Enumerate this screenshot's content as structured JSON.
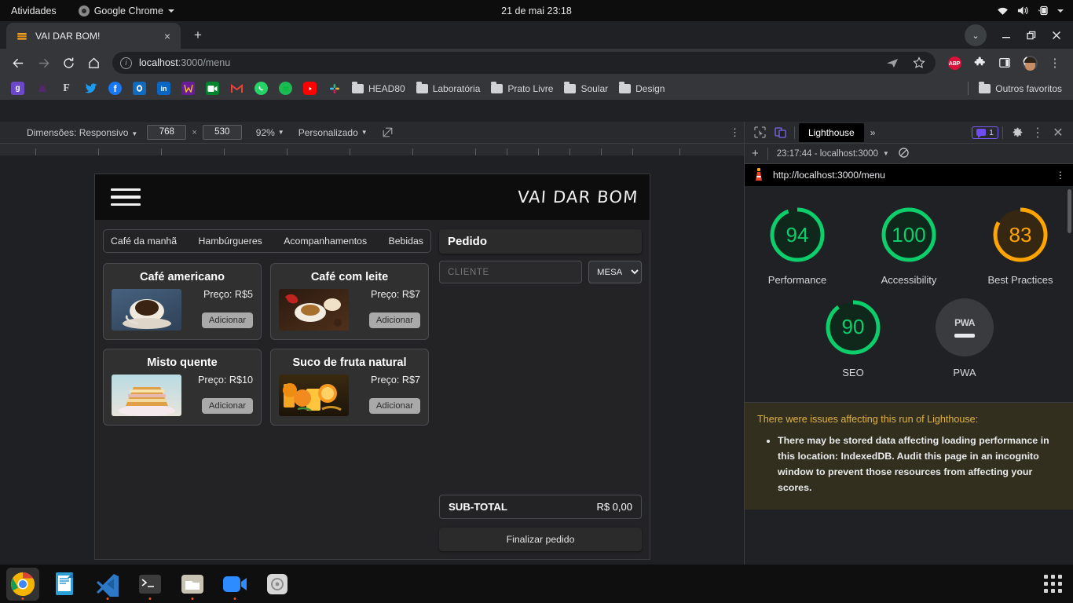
{
  "desktop": {
    "activities": "Atividades",
    "app_menu": "Google Chrome",
    "clock": "21 de mai  23:18",
    "tray": [
      "wifi-icon",
      "volume-icon",
      "battery-icon",
      "chevron-down-icon"
    ]
  },
  "chrome": {
    "tab": {
      "title": "VAI DAR BOM!",
      "favicon": "burger-icon",
      "close": "×"
    },
    "new_tab": "+",
    "window_controls": {
      "minimize": "—",
      "maximize": "❐",
      "close": "✕",
      "chevron": "⌄"
    },
    "nav": {
      "back": "←",
      "forward": "→",
      "reload": "⟳",
      "home": "⌂"
    },
    "omnibox": {
      "info_icon": "info-icon",
      "host": "localhost",
      "path": ":3000/menu",
      "share_icon": "share-icon",
      "star_icon": "star-icon"
    },
    "extensions": {
      "abp": "ABP",
      "puzzle": "extensions-icon",
      "sidepanel": "side-panel-icon",
      "menu": "⋮"
    },
    "bookmarks": {
      "icons": [
        {
          "name": "g-icon",
          "label": "g",
          "bg": "#6b48c8"
        },
        {
          "name": "bucks-icon",
          "label": "",
          "bg": "#4b2a74"
        },
        {
          "name": "f-serif-icon",
          "label": "F",
          "bg": "#1f2833"
        },
        {
          "name": "twitter-icon",
          "label": "",
          "bg": "#1f2833"
        },
        {
          "name": "facebook-icon",
          "label": "f",
          "bg": "#1877f2"
        },
        {
          "name": "outlook-icon",
          "label": "",
          "bg": "#0f6cbd"
        },
        {
          "name": "linkedin-icon",
          "label": "in",
          "bg": "#0a66c2"
        },
        {
          "name": "whats-icon",
          "label": "",
          "bg": "#6a1b9a"
        },
        {
          "name": "meet-icon",
          "label": "",
          "bg": "#00832d"
        },
        {
          "name": "gmail-icon",
          "label": "M",
          "bg": "#1f2833"
        },
        {
          "name": "whatsapp-icon",
          "label": "",
          "bg": "#25d366"
        },
        {
          "name": "spotify-icon",
          "label": "",
          "bg": "#1db954"
        },
        {
          "name": "youtube-icon",
          "label": "",
          "bg": "#ff0000"
        },
        {
          "name": "slack-icon",
          "label": "",
          "bg": "#1f2833"
        }
      ],
      "folders": [
        "HEAD80",
        "Laboratória",
        "Prato Livre",
        "Soular",
        "Design"
      ],
      "other": "Outros favoritos"
    }
  },
  "devtools": {
    "device_bar": {
      "dimensions_label": "Dimensões: Responsivo",
      "width": "768",
      "height": "530",
      "x": "×",
      "zoom": "92%",
      "throttling": "Personalizado",
      "rotate_icon": "rotate-icon",
      "more_icon": "⋮"
    }
  },
  "app": {
    "brand": "VAI DAR BOM",
    "menu_icon": "hamburger-menu-icon",
    "categories": [
      "Café da manhã",
      "Hambúrgueres",
      "Acompanhamentos",
      "Bebidas"
    ],
    "products": [
      {
        "name": "Café americano",
        "price": "Preço: R$5",
        "add": "Adicionar",
        "image": "coffee-cup-photo"
      },
      {
        "name": "Café com leite",
        "price": "Preço: R$7",
        "add": "Adicionar",
        "image": "latte-photo"
      },
      {
        "name": "Misto quente",
        "price": "Preço: R$10",
        "add": "Adicionar",
        "image": "sandwich-photo"
      },
      {
        "name": "Suco de fruta natural",
        "price": "Preço: R$7",
        "add": "Adicionar",
        "image": "orange-juice-photo"
      }
    ],
    "order": {
      "title": "Pedido",
      "client_placeholder": "CLIENTE",
      "client_value": "",
      "table_selected": "MESA",
      "table_options": [
        "MESA"
      ],
      "subtotal_label": "SUB-TOTAL",
      "subtotal_value": "R$ 0,00",
      "finish_label": "Finalizar pedido"
    }
  },
  "lighthouse": {
    "tab_label": "Lighthouse",
    "more_tabs": "»",
    "issues_count": "1",
    "settings_icon": "gear-icon",
    "menu_icon": "⋮",
    "close_icon": "✕",
    "inspect_icon": "inspect-icon",
    "device_icon": "device-toggle-icon",
    "new_run": "+",
    "run_label": "23:17:44 - localhost:3000",
    "clear_icon": "no-entry-icon",
    "report_url": "http://localhost:3000/menu",
    "report_icon": "lighthouse-icon",
    "report_menu": "⋮",
    "scores": [
      {
        "label": "Performance",
        "value": 94,
        "color": "#0cce6b"
      },
      {
        "label": "Accessibility",
        "value": 100,
        "color": "#0cce6b"
      },
      {
        "label": "Best Practices",
        "value": 83,
        "color": "#ffa400"
      },
      {
        "label": "SEO",
        "value": 90,
        "color": "#0cce6b"
      },
      {
        "label": "PWA",
        "value": null,
        "color": "#a8aaad",
        "badge": "PWA"
      }
    ],
    "warning": {
      "title": "There were issues affecting this run of Lighthouse:",
      "items": [
        "There may be stored data affecting loading performance in this location: IndexedDB. Audit this page in an incognito window to prevent those resources from affecting your scores."
      ]
    }
  },
  "dock": {
    "items": [
      "chrome-icon",
      "libreoffice-writer-icon",
      "vscode-icon",
      "terminal-icon",
      "files-icon",
      "zoom-icon",
      "settings-icon"
    ],
    "show_apps": "show-applications-icon"
  }
}
